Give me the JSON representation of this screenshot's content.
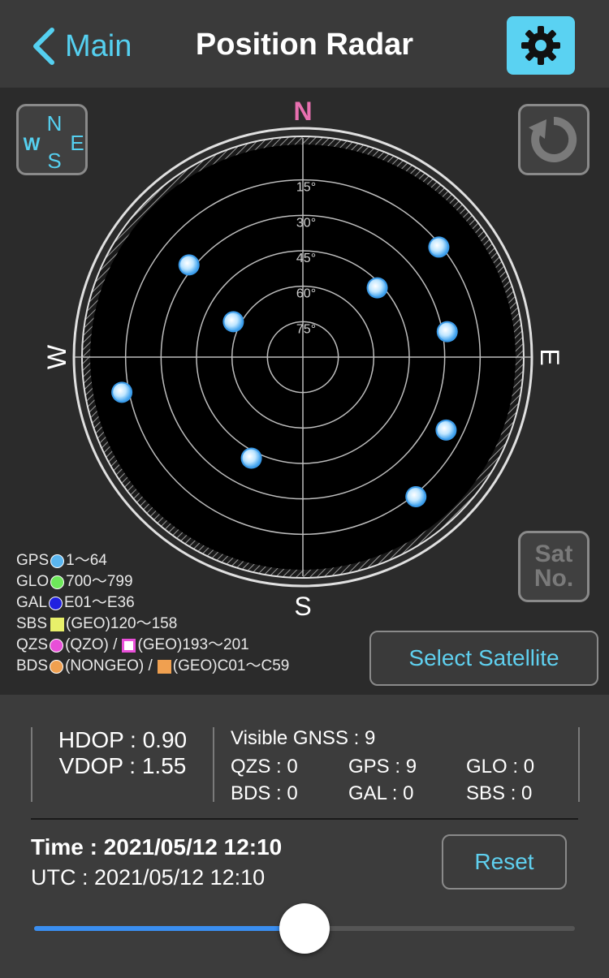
{
  "nav": {
    "back_label": "Main",
    "title": "Position Radar",
    "settings_icon": "gear-icon"
  },
  "radar": {
    "directions": {
      "n": "N",
      "e": "E",
      "s": "S",
      "w": "W"
    },
    "elevation_labels": [
      "15°",
      "30°",
      "45°",
      "60°",
      "75°"
    ],
    "satellites": [
      {
        "system": "GPS",
        "azimuth": 51,
        "elevation": 16
      },
      {
        "system": "GPS",
        "azimuth": 47,
        "elevation": 47
      },
      {
        "system": "GPS",
        "azimuth": 80,
        "elevation": 28
      },
      {
        "system": "GPS",
        "azimuth": 117,
        "elevation": 22
      },
      {
        "system": "GPS",
        "azimuth": 141,
        "elevation": 14
      },
      {
        "system": "GPS",
        "azimuth": 207,
        "elevation": 42
      },
      {
        "system": "GPS",
        "azimuth": 259,
        "elevation": 12
      },
      {
        "system": "GPS",
        "azimuth": 297,
        "elevation": 57
      },
      {
        "system": "GPS",
        "azimuth": 309,
        "elevation": 28
      }
    ],
    "colors": {
      "N": "#e870b0",
      "accent": "#55d0f0"
    },
    "sat_no_line1": "Sat",
    "sat_no_line2": "No."
  },
  "legend": {
    "gps": {
      "label": "GPS",
      "range": "1～64",
      "color": "#5ab6f0"
    },
    "glo": {
      "label": "GLO",
      "range": "700～799",
      "color": "#6ee85a"
    },
    "gal": {
      "label": "GAL",
      "range": "E01～E36",
      "color": "#2020e0"
    },
    "sbs": {
      "label": "SBS",
      "range": "(GEO)120～158",
      "color": "#e8f06a"
    },
    "qzs": {
      "label": "QZS",
      "range1": "(QZO) /",
      "range2": "(GEO)193～201",
      "color": "#e84fd8"
    },
    "bds": {
      "label": "BDS",
      "range1": "(NONGEO) /",
      "range2": "(GEO)C01～C59",
      "color": "#f0a050"
    }
  },
  "select_satellite_label": "Select Satellite",
  "dop": {
    "hdop": "HDOP : 0.90",
    "vdop": "VDOP : 1.55"
  },
  "gnss": {
    "visible": "Visible GNSS : 9",
    "qzs": "QZS : 0",
    "gps": "GPS : 9",
    "glo": "GLO : 0",
    "bds": "BDS : 0",
    "gal": "GAL : 0",
    "sbs": "SBS : 0"
  },
  "time": {
    "local": "Time : 2021/05/12 12:10",
    "utc": "UTC : 2021/05/12 12:10"
  },
  "reset_label": "Reset",
  "slider": {
    "value": 0.5
  }
}
